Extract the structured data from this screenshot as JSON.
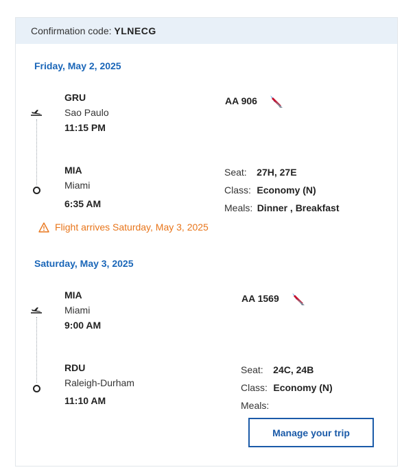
{
  "confirmation": {
    "label": "Confirmation code:",
    "code": "YLNECG"
  },
  "segments": [
    {
      "date": "Friday, May 2, 2025",
      "flight_number": "AA 906",
      "origin": {
        "code": "GRU",
        "city": "Sao Paulo",
        "time": "11:15 PM"
      },
      "destination": {
        "code": "MIA",
        "city": "Miami",
        "time": "6:35 AM"
      },
      "seat_label": "Seat:",
      "seat": "27H, 27E",
      "class_label": "Class:",
      "class": "Economy (N)",
      "meals_label": "Meals:",
      "meals": "Dinner , Breakfast",
      "warning": "Flight arrives Saturday, May 3, 2025"
    },
    {
      "date": "Saturday, May 3, 2025",
      "flight_number": "AA 1569",
      "origin": {
        "code": "MIA",
        "city": "Miami",
        "time": "9:00 AM"
      },
      "destination": {
        "code": "RDU",
        "city": "Raleigh-Durham",
        "time": "11:10 AM"
      },
      "seat_label": "Seat:",
      "seat": "24C, 24B",
      "class_label": "Class:",
      "class": "Economy (N)",
      "meals_label": "Meals:",
      "meals": ""
    }
  ],
  "manage_button": "Manage your trip",
  "colors": {
    "accent": "#1a66b8",
    "warning": "#e8751a",
    "header_bg": "#e8f0f8"
  },
  "icons": [
    "plane-departure-icon",
    "airline-logo-icon",
    "warning-icon",
    "destination-circle-icon"
  ]
}
